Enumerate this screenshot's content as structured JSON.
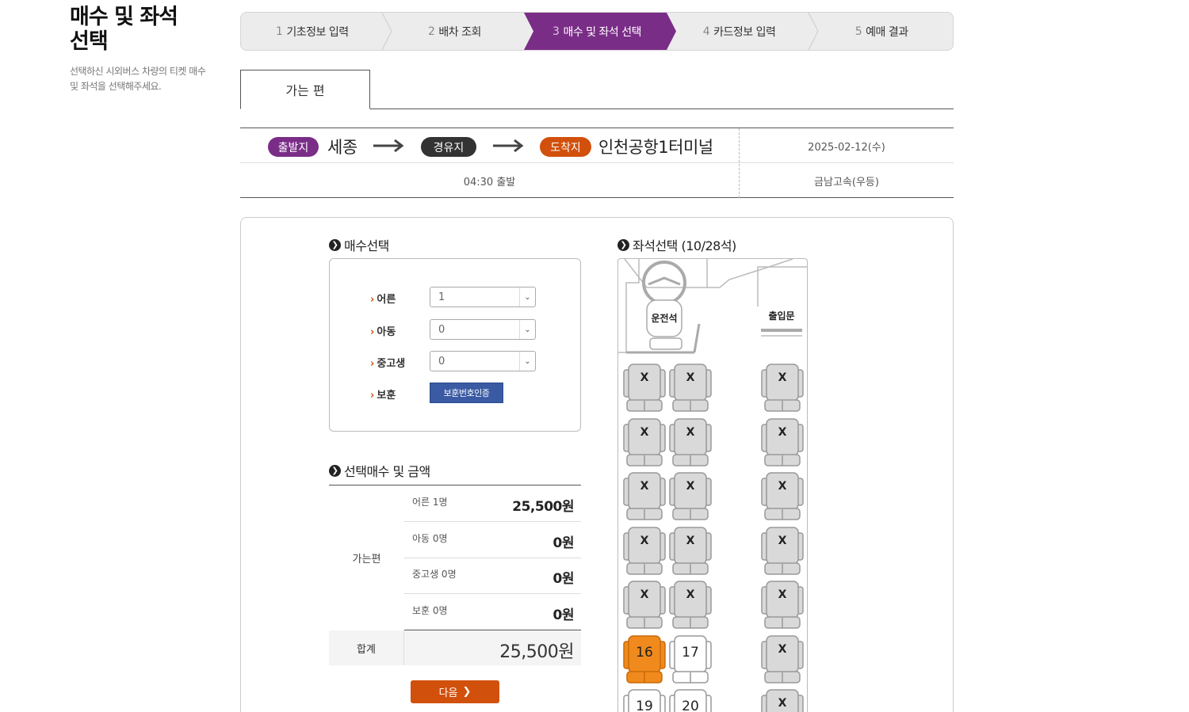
{
  "page": {
    "title": "매수 및 좌석 선택",
    "description": "선택하신 시외버스 차량의 티켓 매수 및 좌석을 선택해주세요."
  },
  "steps": [
    {
      "num": "1",
      "label": "기초정보 입력",
      "active": false
    },
    {
      "num": "2",
      "label": "배차 조회",
      "active": false
    },
    {
      "num": "3",
      "label": "매수 및 좌석 선택",
      "active": true
    },
    {
      "num": "4",
      "label": "카드정보 입력",
      "active": false
    },
    {
      "num": "5",
      "label": "예매 결과",
      "active": false
    }
  ],
  "tab": {
    "label": "가는 편"
  },
  "route": {
    "departure_badge": "출발지",
    "departure": "세종",
    "via_badge": "경유지",
    "arrival_badge": "도착지",
    "arrival": "인천공항1터미널",
    "date": "2025-02-12(수)",
    "time": "04:30 출발",
    "company": "금남고속(우등)",
    "colors": {
      "departure": "#7a2d87",
      "via": "#333333",
      "arrival": "#d1500c"
    }
  },
  "count_section": {
    "title": "매수선택",
    "rows": [
      {
        "label": "어른",
        "value": "1"
      },
      {
        "label": "아동",
        "value": "0"
      },
      {
        "label": "중고생",
        "value": "0"
      }
    ],
    "veteran_label": "보훈",
    "veteran_button": "보훈번호인증"
  },
  "price_section": {
    "title": "선택매수 및 금액",
    "direction": "가는편",
    "rows": [
      {
        "label": "어른 1명",
        "value": "25,500원"
      },
      {
        "label": "아동 0명",
        "value": "0원"
      },
      {
        "label": "중고생 0명",
        "value": "0원"
      },
      {
        "label": "보훈 0명",
        "value": "0원"
      }
    ],
    "total_label": "합계",
    "total_value": "25,500원"
  },
  "next_button": "다음",
  "seat_section": {
    "title": "좌석선택 (10/28석)",
    "driver_label": "운전석",
    "door_label": "출입문",
    "taken_mark": "X",
    "seats": [
      {
        "row": 0,
        "col": 0,
        "state": "taken",
        "label": "X"
      },
      {
        "row": 0,
        "col": 1,
        "state": "taken",
        "label": "X"
      },
      {
        "row": 0,
        "col": 2,
        "state": "taken",
        "label": "X"
      },
      {
        "row": 1,
        "col": 0,
        "state": "taken",
        "label": "X"
      },
      {
        "row": 1,
        "col": 1,
        "state": "taken",
        "label": "X"
      },
      {
        "row": 1,
        "col": 2,
        "state": "taken",
        "label": "X"
      },
      {
        "row": 2,
        "col": 0,
        "state": "taken",
        "label": "X"
      },
      {
        "row": 2,
        "col": 1,
        "state": "taken",
        "label": "X"
      },
      {
        "row": 2,
        "col": 2,
        "state": "taken",
        "label": "X"
      },
      {
        "row": 3,
        "col": 0,
        "state": "taken",
        "label": "X"
      },
      {
        "row": 3,
        "col": 1,
        "state": "taken",
        "label": "X"
      },
      {
        "row": 3,
        "col": 2,
        "state": "taken",
        "label": "X"
      },
      {
        "row": 4,
        "col": 0,
        "state": "taken",
        "label": "X"
      },
      {
        "row": 4,
        "col": 1,
        "state": "taken",
        "label": "X"
      },
      {
        "row": 4,
        "col": 2,
        "state": "taken",
        "label": "X"
      },
      {
        "row": 5,
        "col": 0,
        "state": "selected",
        "label": "16"
      },
      {
        "row": 5,
        "col": 1,
        "state": "avail",
        "label": "17"
      },
      {
        "row": 5,
        "col": 2,
        "state": "taken",
        "label": "X"
      },
      {
        "row": 6,
        "col": 0,
        "state": "avail",
        "label": "19"
      },
      {
        "row": 6,
        "col": 1,
        "state": "avail",
        "label": "20"
      },
      {
        "row": 6,
        "col": 2,
        "state": "taken",
        "label": "X"
      }
    ],
    "colors": {
      "selected": "#f08a1c",
      "taken": "#d9d9d9",
      "avail": "#ffffff"
    }
  }
}
